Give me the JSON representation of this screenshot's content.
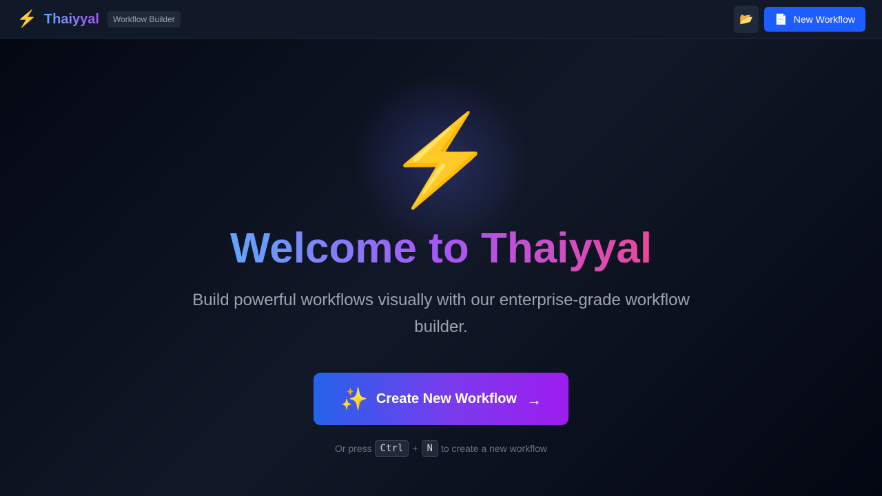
{
  "header": {
    "brand_icon": "⚡",
    "brand_name": "Thaiyyal",
    "brand_badge": "Workflow Builder",
    "open_icon": "📂",
    "new_button_icon": "📄",
    "new_button_label": "New Workflow"
  },
  "hero": {
    "icon": "⚡",
    "title": "Welcome to Thaiyyal",
    "subtitle": "Build powerful workflows visually with our enterprise-grade workflow builder.",
    "cta_icon": "✨",
    "cta_label": "Create New Workflow",
    "cta_arrow": "→",
    "hint_prefix": "Or press",
    "hint_key1": "Ctrl",
    "hint_plus": "+",
    "hint_key2": "N",
    "hint_suffix": "to create a new workflow"
  },
  "colors": {
    "accent": "#1d5cff",
    "gradient_start": "#60a5fa",
    "gradient_mid": "#a855f7",
    "gradient_end": "#ec4899"
  }
}
